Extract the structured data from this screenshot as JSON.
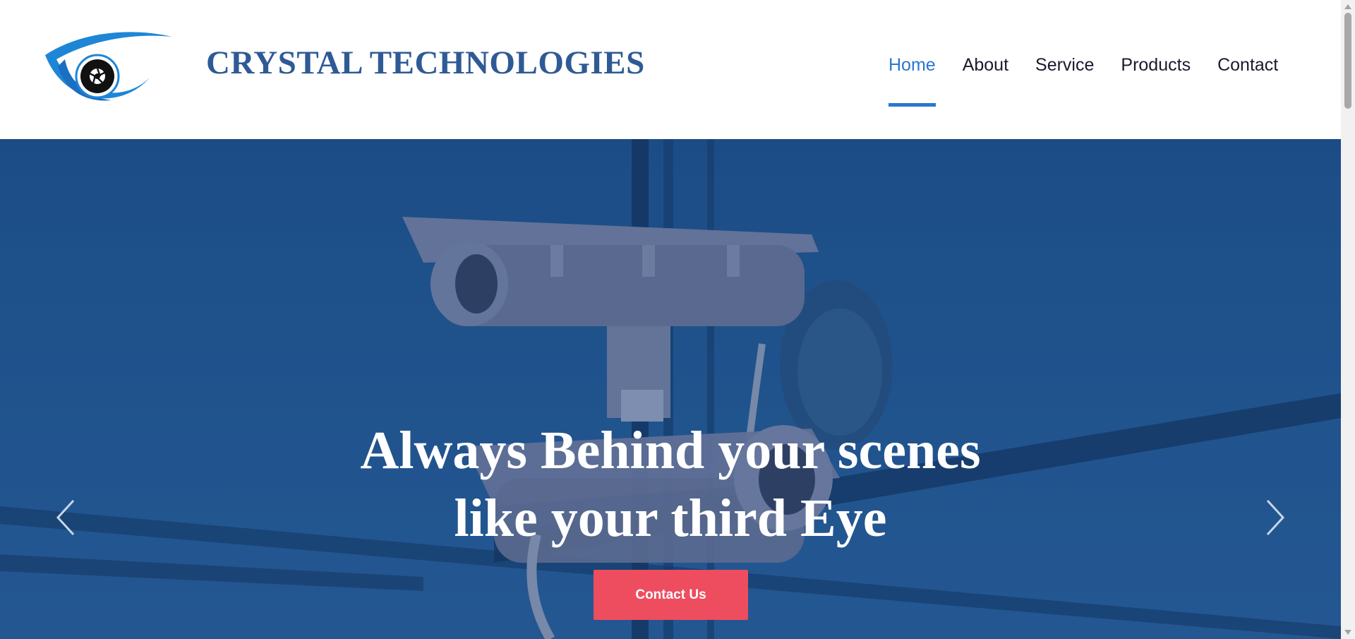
{
  "brand": {
    "name": "CRYSTAL TECHNOLOGIES",
    "logo_icon": "eye-camera-logo",
    "color": "#2e5a96"
  },
  "nav": {
    "items": [
      {
        "label": "Home",
        "active": true
      },
      {
        "label": "About",
        "active": false
      },
      {
        "label": "Service",
        "active": false
      },
      {
        "label": "Products",
        "active": false
      },
      {
        "label": "Contact",
        "active": false
      }
    ],
    "active_color": "#2a76d2"
  },
  "hero": {
    "title_line1": "Always Behind your scenes",
    "title_line2": "like your third Eye",
    "cta_label": "Contact Us",
    "cta_color": "#ee4d5f",
    "prev_icon": "chevron-left-icon",
    "next_icon": "chevron-right-icon"
  }
}
